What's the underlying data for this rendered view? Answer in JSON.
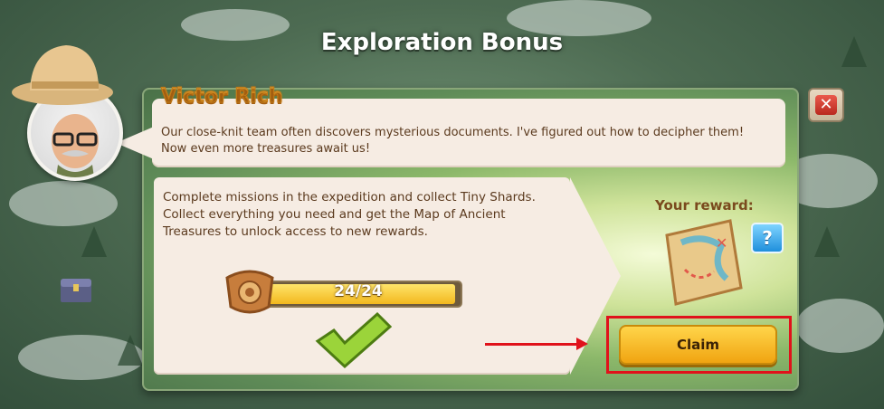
{
  "dialog": {
    "title": "Exploration Bonus",
    "close_icon": "close-icon"
  },
  "speaker": {
    "name": "Victor Rich",
    "message": "Our close-knit team often discovers mysterious documents. I've figured out how to decipher them! Now even more treasures await us!"
  },
  "mission": {
    "description": "Complete missions in the expedition and collect Tiny Shards. Collect everything you need and get the Map of Ancient Treasures to unlock access to new rewards.",
    "progress_text": "24/24",
    "progress_fraction": 1.0,
    "shard_icon": "tiny-shard-icon",
    "status_icon": "checkmark-icon"
  },
  "reward": {
    "label": "Your reward:",
    "item_icon": "treasure-map-icon",
    "help_label": "?"
  },
  "actions": {
    "claim_label": "Claim"
  },
  "colors": {
    "accent_yellow": "#f0a411",
    "highlight_red": "#e0121b",
    "close_red": "#b9281f",
    "text_brown": "#5b3a1e"
  }
}
